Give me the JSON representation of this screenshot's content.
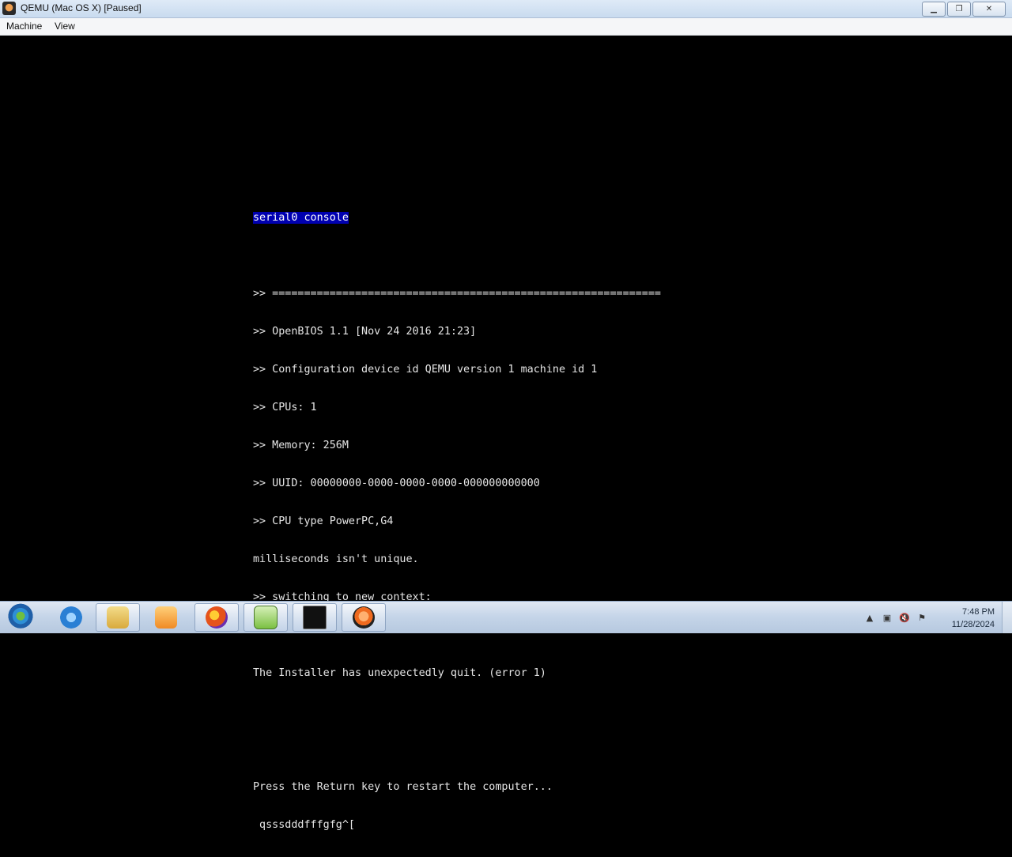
{
  "window": {
    "title": "QEMU (Mac OS X) [Paused]",
    "buttons": {
      "minimize": "▁",
      "maximize": "❐",
      "close": "✕"
    }
  },
  "menu": {
    "items": [
      "Machine",
      "View"
    ]
  },
  "console": {
    "title": "serial0 console",
    "lines": [
      "",
      ">> =============================================================",
      ">> OpenBIOS 1.1 [Nov 24 2016 21:23]",
      ">> Configuration device id QEMU version 1 machine id 1",
      ">> CPUs: 1",
      ">> Memory: 256M",
      ">> UUID: 00000000-0000-0000-0000-000000000000",
      ">> CPU type PowerPC,G4",
      "milliseconds isn't unique.",
      ">> switching to new context:",
      "",
      "The Installer has unexpectedly quit. (error 1)",
      "",
      "",
      "Press the Return key to restart the computer...",
      " qsssdddfffgfg^["
    ]
  },
  "taskbar": {
    "apps": [
      {
        "name": "internet-explorer-icon",
        "color": "#2a7fd4"
      },
      {
        "name": "file-explorer-icon",
        "color": "#e8c25a"
      },
      {
        "name": "media-player-icon",
        "color": "#f08a24"
      },
      {
        "name": "firefox-icon",
        "color": "#e5531b"
      },
      {
        "name": "notepad-plus-plus-icon",
        "color": "#7bc043"
      },
      {
        "name": "command-prompt-icon",
        "color": "#111111"
      },
      {
        "name": "qemu-icon",
        "color": "#ef6a1f"
      }
    ],
    "clock": {
      "time": "7:48 PM",
      "date": "11/28/2024"
    }
  }
}
